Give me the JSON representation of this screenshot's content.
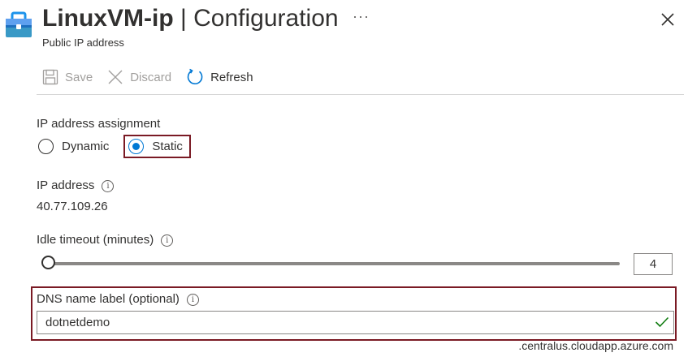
{
  "header": {
    "title_strong": "LinuxVM-ip",
    "title_sep": " | ",
    "title_rest": "Configuration",
    "subtitle": "Public IP address",
    "more": "···"
  },
  "toolbar": {
    "save_label": "Save",
    "discard_label": "Discard",
    "refresh_label": "Refresh"
  },
  "ip_assignment": {
    "label": "IP address assignment",
    "options": [
      {
        "label": "Dynamic",
        "selected": false
      },
      {
        "label": "Static",
        "selected": true
      }
    ]
  },
  "ip_address": {
    "label": "IP address",
    "value": "40.77.109.26"
  },
  "idle_timeout": {
    "label": "Idle timeout (minutes)",
    "value": "4",
    "level_fraction": 0
  },
  "dns": {
    "label": "DNS name label (optional)",
    "value": "dotnetdemo",
    "suffix": ".centralus.cloudapp.azure.com"
  },
  "colors": {
    "accent": "#0078d4",
    "highlight_border": "#7a1a24",
    "valid_check": "#107c10"
  },
  "info_glyph": "i"
}
